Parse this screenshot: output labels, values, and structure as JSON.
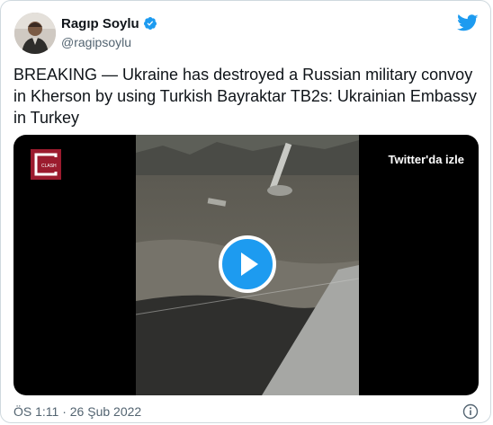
{
  "author": {
    "name": "Ragıp Soylu",
    "handle": "@ragipsoylu",
    "verified": true,
    "avatar_icon": "person-avatar"
  },
  "tweet": {
    "text": "BREAKING — Ukraine has destroyed a Russian military convoy in Kherson by using Turkish Bayraktar TB2s: Ukrainian Embassy in Turkey",
    "timestamp": "ÖS 1:11 · 26 Şub 2022"
  },
  "media": {
    "watch_label": "Twitter'da izle",
    "channel_logo_text": "CLASH",
    "play_icon": "play-icon"
  },
  "colors": {
    "accent": "#1d9bf0",
    "text": "#0f1419",
    "muted": "#536471",
    "border": "#cfd9de",
    "channel_logo": "#9b1b2e"
  },
  "icons": {
    "brand": "twitter-bird-icon",
    "verified": "verified-badge-icon",
    "info": "info-icon"
  }
}
